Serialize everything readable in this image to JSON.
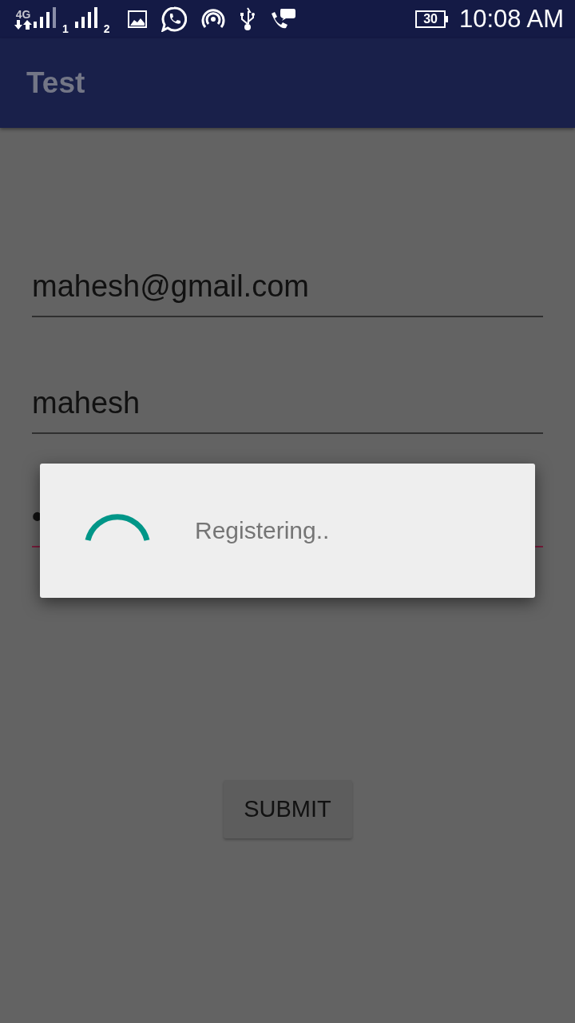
{
  "status_bar": {
    "network": "4G",
    "sim_1": "1",
    "sim_2": "2",
    "battery": "30",
    "time": "10:08 AM"
  },
  "app_bar": {
    "title": "Test"
  },
  "fields": [
    {
      "kind": "text",
      "value": "mahesh@gmail.com",
      "focused": false
    },
    {
      "kind": "text",
      "value": "mahesh",
      "focused": false
    },
    {
      "kind": "password",
      "value": "•",
      "focused": true
    }
  ],
  "submit_button": {
    "label": "SUBMIT"
  },
  "dialog": {
    "message": "Registering.."
  }
}
